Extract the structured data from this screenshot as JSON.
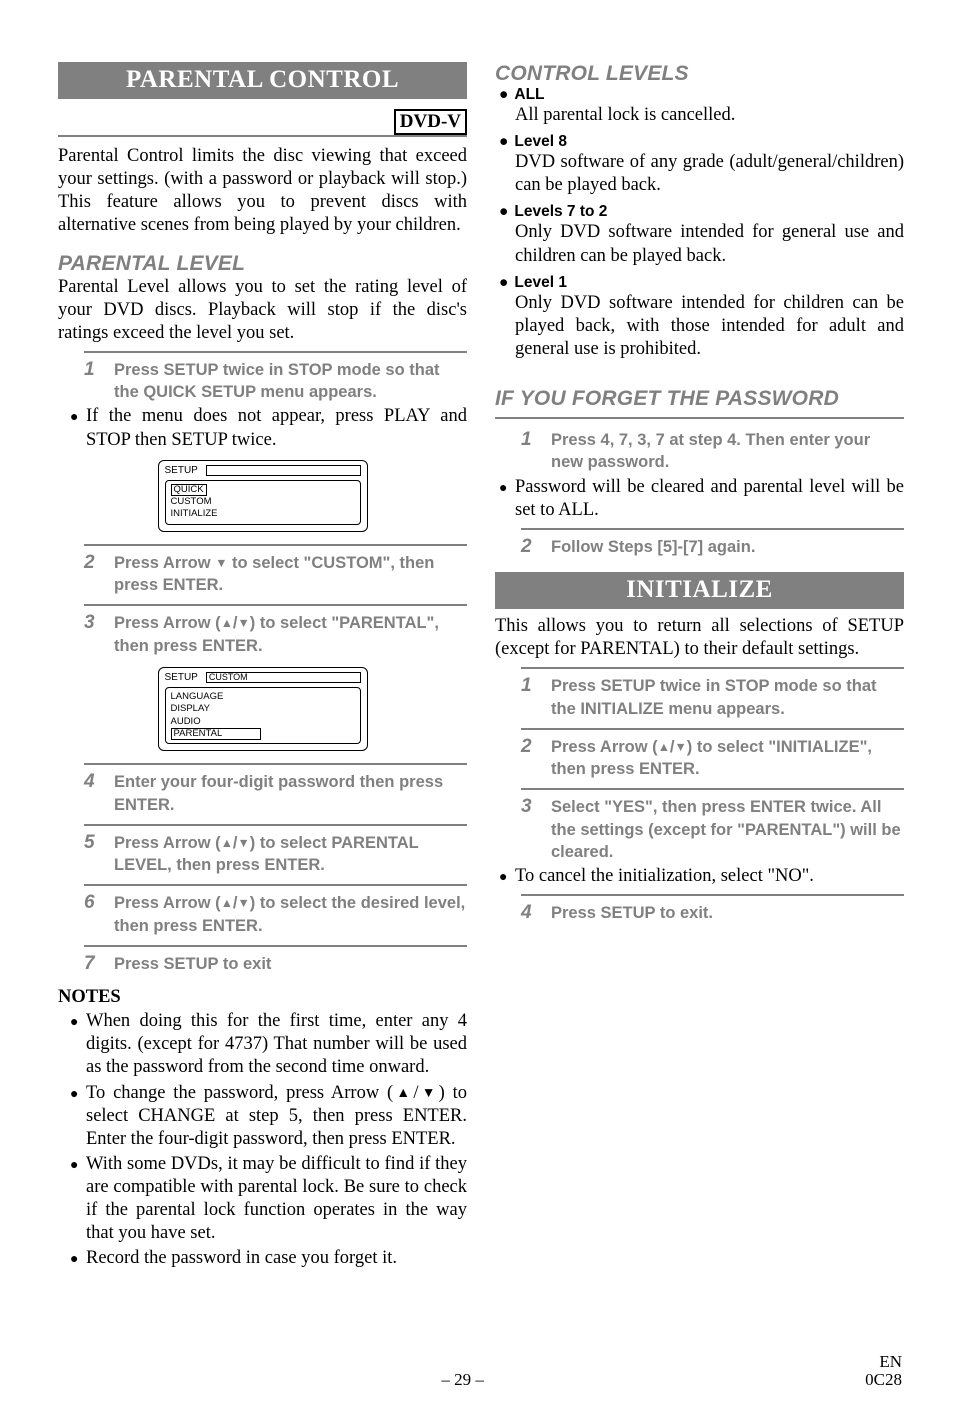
{
  "left": {
    "section_title": "PARENTAL CONTROL",
    "dvd_badge": "DVD-V",
    "intro": "Parental Control limits the disc viewing that exceed your settings. (with a password or playback will stop.) This feature allows you to prevent discs with alternative scenes from being played by your children.",
    "parental_level": {
      "heading": "PARENTAL LEVEL",
      "body": "Parental Level allows you to set the rating level of your DVD discs. Playback will stop if the disc's ratings exceed the level you set.",
      "steps": {
        "s1_num": "1",
        "s1": "Press SETUP twice in STOP mode so that the QUICK SETUP menu appears.",
        "s1_bullet": "If the menu does not appear, press PLAY and STOP then SETUP twice.",
        "s2_num": "2",
        "s2_pre": "Press Arrow ",
        "s2_post": " to select \"CUSTOM\", then press ENTER.",
        "s3_num": "3",
        "s3_pre": "Press Arrow (",
        "s3_mid": "/",
        "s3_post": ") to select \"PARENTAL\", then press ENTER.",
        "s4_num": "4",
        "s4": "Enter your four-digit password then press ENTER.",
        "s5_num": "5",
        "s5_pre": "Press Arrow (",
        "s5_mid": "/",
        "s5_post": ") to select PARENTAL LEVEL, then press ENTER.",
        "s6_num": "6",
        "s6_pre": "Press Arrow (",
        "s6_mid": "/",
        "s6_post": ") to select the desired level, then press ENTER.",
        "s7_num": "7",
        "s7": "Press SETUP to exit"
      },
      "diagram1": {
        "title": "SETUP",
        "items": [
          "QUICK",
          "CUSTOM",
          "INITIALIZE"
        ]
      },
      "diagram2": {
        "title": "SETUP",
        "box_label": "CUSTOM",
        "items": [
          "LANGUAGE",
          "DISPLAY",
          "AUDIO",
          "PARENTAL"
        ]
      }
    },
    "notes": {
      "heading": "NOTES",
      "n1": "When doing this for the first time, enter any 4 digits. (except for 4737) That number will be used as the password from the second time onward.",
      "n2_pre": "To change the password, press Arrow (",
      "n2_mid": "/",
      "n2_post": ") to select CHANGE at step 5, then press ENTER. Enter the four-digit password, then press ENTER.",
      "n3": "With some DVDs, it may be difficult to find if they are compatible with parental lock. Be sure to check if the parental lock function operates in the way that you have set.",
      "n4": "Record the password in case you forget it."
    }
  },
  "right": {
    "control_levels": {
      "heading": "CONTROL LEVELS",
      "items": [
        {
          "label": "ALL",
          "body": "All parental lock is cancelled."
        },
        {
          "label": "Level 8",
          "body": "DVD software of any grade (adult/general/children) can be played back."
        },
        {
          "label": "Levels 7 to 2",
          "body": "Only DVD software intended for general use and children can be played back."
        },
        {
          "label": "Level 1",
          "body": "Only DVD software intended for children can be played back, with those intended for adult and general use is prohibited."
        }
      ]
    },
    "forget_pw": {
      "heading": "IF YOU FORGET THE PASSWORD",
      "s1_num": "1",
      "s1": "Press 4, 7, 3, 7 at step 4. Then enter your new password.",
      "bullet": "Password will be cleared and parental level will be set to ALL.",
      "s2_num": "2",
      "s2": "Follow Steps [5]-[7] again."
    },
    "initialize": {
      "title": "INITIALIZE",
      "body": "This allows you to return all selections of SETUP (except for PARENTAL) to their default settings.",
      "s1_num": "1",
      "s1": "Press SETUP twice in STOP mode so that the INITIALIZE menu appears.",
      "s2_num": "2",
      "s2_pre": "Press Arrow (",
      "s2_mid": "/",
      "s2_post": ") to select \"INITIALIZE\", then press ENTER.",
      "s3_num": "3",
      "s3": "Select \"YES\", then press ENTER twice. All the settings (except for \"PARENTAL\") will be cleared.",
      "bullet": "To cancel the initialization, select \"NO\".",
      "s4_num": "4",
      "s4": "Press SETUP to exit."
    }
  },
  "footer": {
    "page": "– 29 –",
    "code1": "EN",
    "code2": "0C28"
  }
}
